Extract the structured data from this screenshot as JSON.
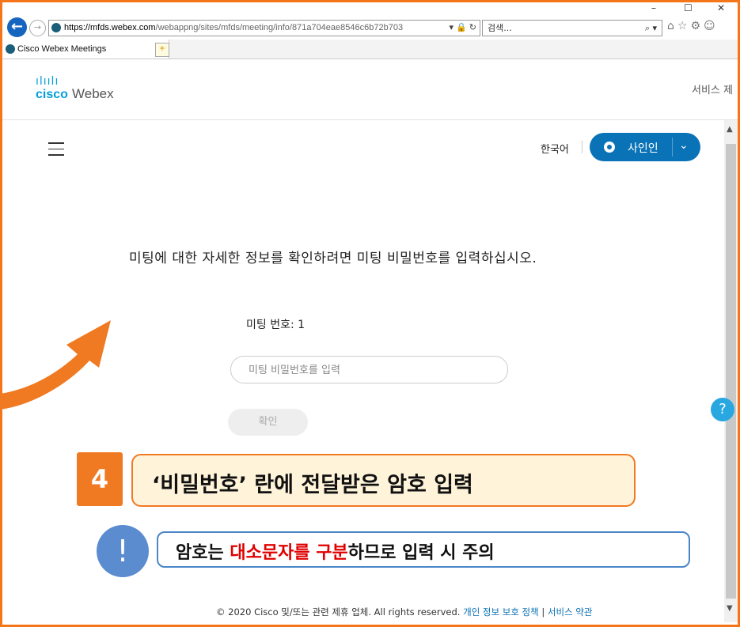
{
  "browser": {
    "address": {
      "url_host": "https://mfds.webex.com",
      "url_path": "/webappng/sites/mfds/meeting/info/871a704eae8546c6b72b703"
    },
    "search_placeholder": "검색...",
    "tab_title": "Cisco Webex Meetings"
  },
  "site": {
    "logo_text": "cisco",
    "logo_product": "Webex",
    "service_link": "서비스 제"
  },
  "page": {
    "language": "한국어",
    "signin_label": "사인인",
    "prompt": "미팅에 대한 자세한 정보를 확인하려면 미팅 비밀번호를 입력하십시오.",
    "meeting_number_label": "미팅 번호: 1",
    "password_placeholder": "미팅 비밀번호를 입력",
    "confirm_label": "확인"
  },
  "footer": {
    "copyright": "© 2020 Cisco 및/또는 관련 제휴 업체. All rights reserved.",
    "privacy": "개인 정보 보호 정책",
    "separator": "|",
    "terms": "서비스 약관"
  },
  "overlay": {
    "step_number": "4",
    "step_text": "‘비밀번호’ 란에 전달받은 암호 입력",
    "warn_mark": "!",
    "warn_part1": "암호는 ",
    "warn_highlight": "대소문자를 구분",
    "warn_part2": "하므로 입력 시 주의"
  },
  "colors": {
    "accent": "#0a72b7",
    "callout_orange": "#f07a22",
    "frame": "#f5761a",
    "warn_blue": "#4a86c8"
  }
}
